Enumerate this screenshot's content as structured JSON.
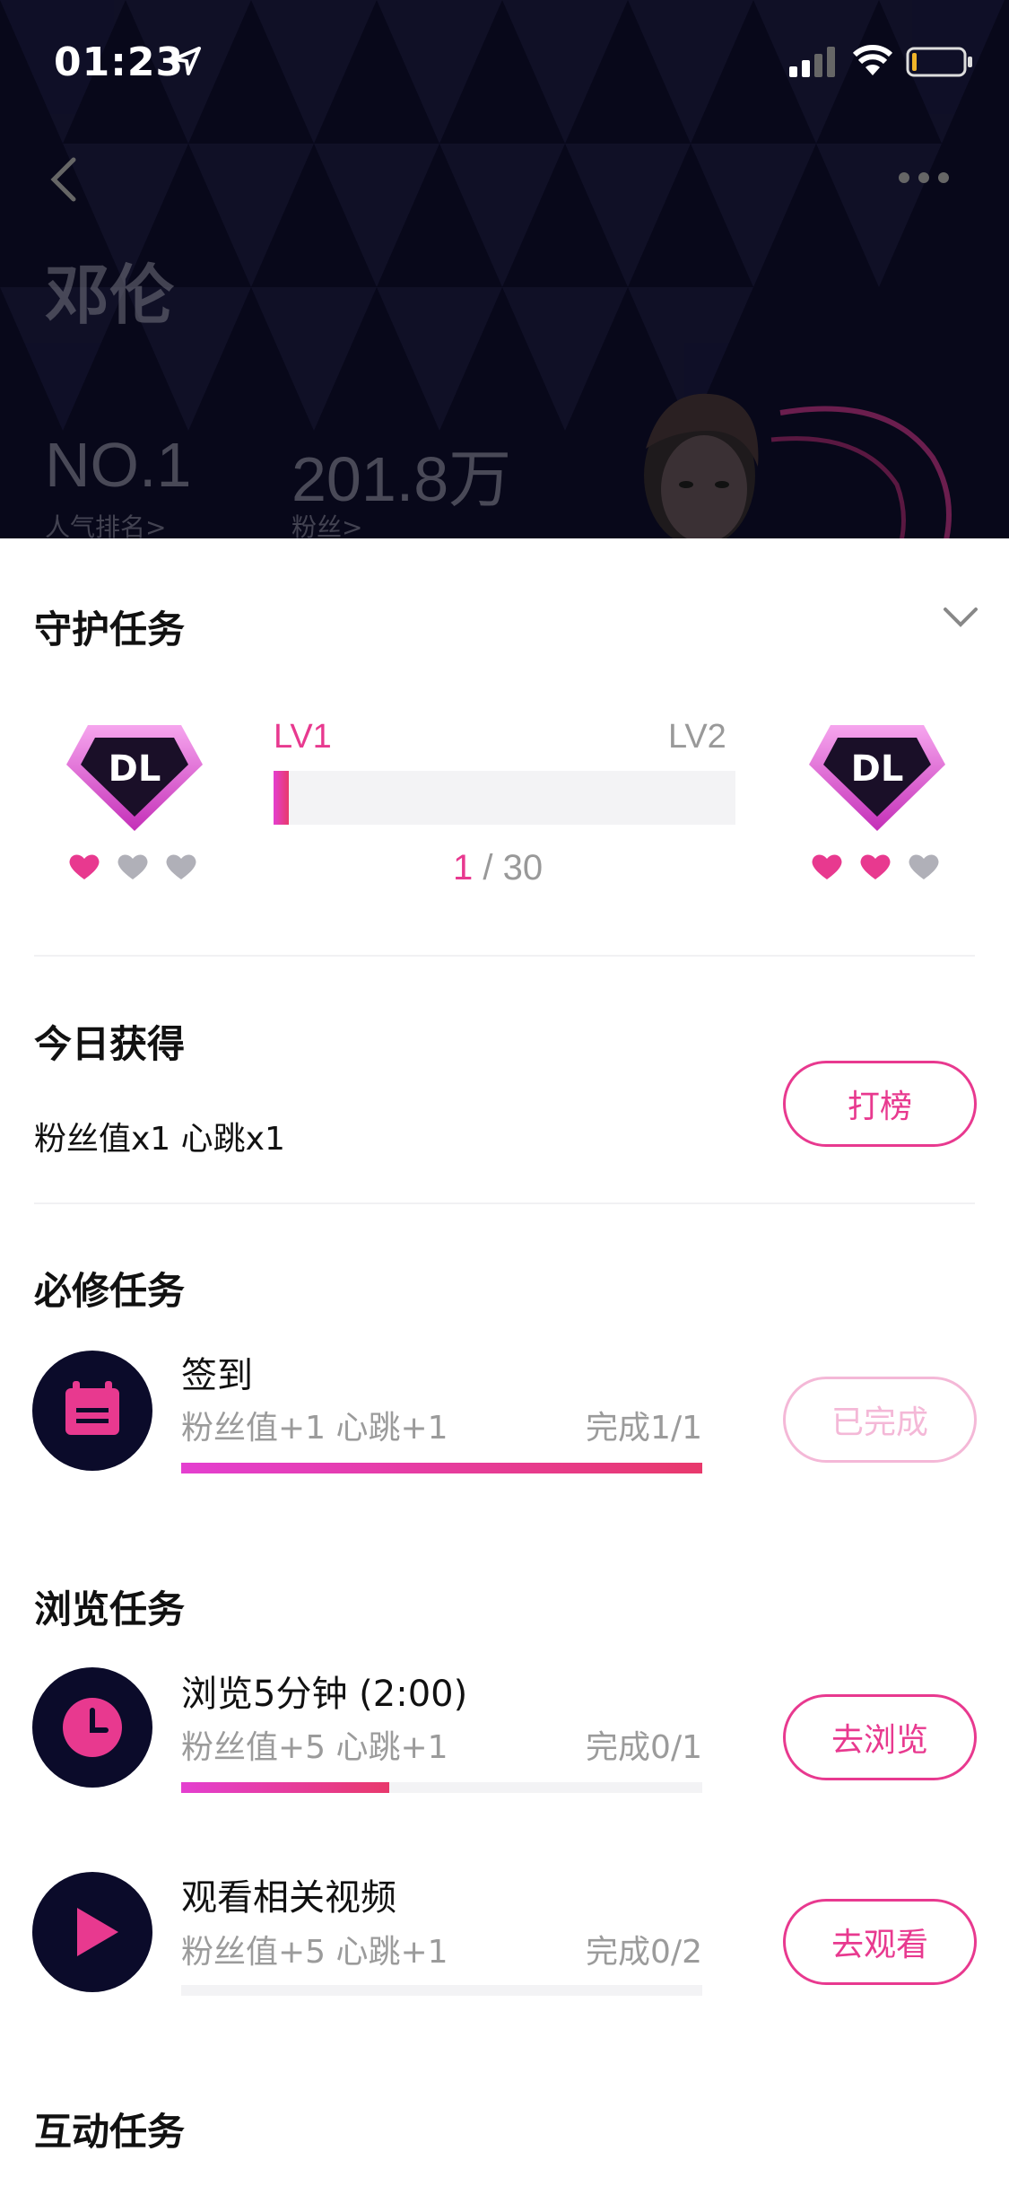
{
  "status_bar": {
    "time": "01:23"
  },
  "hero": {
    "artist_name": "邓伦",
    "rank_value": "NO.1",
    "rank_label": "人气排名>",
    "fans_value": "201.8万",
    "fans_label": "粉丝>"
  },
  "guard_task": {
    "title": "守护任务",
    "current_level": "LV1",
    "next_level": "LV2",
    "progress_current": "1",
    "progress_separator": " / ",
    "progress_total": "30",
    "progress_fraction": 0.033,
    "current_badge_hearts_filled": 1,
    "next_badge_hearts_filled": 2,
    "hearts_total": 3
  },
  "today": {
    "title": "今日获得",
    "detail": "粉丝值x1 心跳x1",
    "button_label": "打榜"
  },
  "required_tasks": {
    "title": "必修任务",
    "items": [
      {
        "icon": "calendar-icon",
        "title": "签到",
        "reward": "粉丝值+1 心跳+1",
        "progress": "完成1/1",
        "fraction": 1.0,
        "button_label": "已完成",
        "done": true
      }
    ]
  },
  "browse_tasks": {
    "title": "浏览任务",
    "items": [
      {
        "icon": "clock-icon",
        "title": "浏览5分钟 (2:00)",
        "reward": "粉丝值+5 心跳+1",
        "progress": "完成0/1",
        "fraction": 0.4,
        "button_label": "去浏览",
        "done": false
      },
      {
        "icon": "play-icon",
        "title": "观看相关视频",
        "reward": "粉丝值+5 心跳+1",
        "progress": "完成0/2",
        "fraction": 0.0,
        "button_label": "去观看",
        "done": false
      }
    ]
  },
  "interact_tasks": {
    "title": "互动任务"
  },
  "colors": {
    "accent": "#e8398f",
    "gradient_start": "#e43fd0",
    "gradient_end": "#e8396c",
    "hero_bg": "#08081a",
    "muted": "#9b9b9b"
  }
}
